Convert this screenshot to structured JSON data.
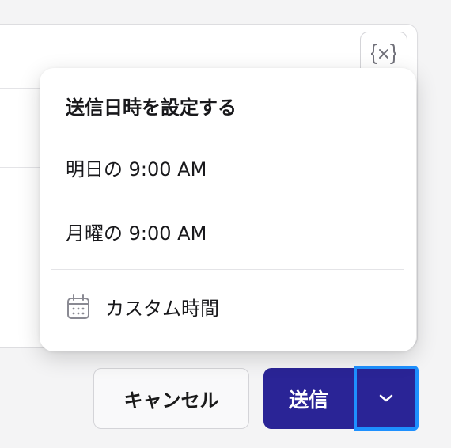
{
  "schedule_menu": {
    "title": "送信日時を設定する",
    "options": [
      {
        "label": "明日の 9:00 AM"
      },
      {
        "label": "月曜の 9:00 AM"
      }
    ],
    "custom": {
      "label": "カスタム時間",
      "icon": "calendar-icon"
    }
  },
  "toolbar": {
    "variable_button_icon": "curly-braces-variable-icon"
  },
  "footer": {
    "cancel_label": "キャンセル",
    "send_label": "送信",
    "send_menu_icon": "chevron-down-icon"
  },
  "colors": {
    "primary": "#2a2496",
    "focus_ring": "#1e90ff",
    "background": "#f4f4f5"
  }
}
